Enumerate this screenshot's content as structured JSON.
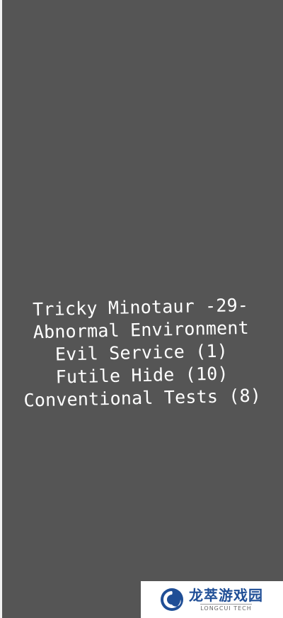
{
  "menu": {
    "items": [
      "Tricky Minotaur -29-",
      "Abnormal Environment",
      "Evil Service (1)",
      "Futile Hide (10)",
      "Conventional Tests (8)"
    ]
  },
  "watermark": {
    "name_cn": "龙萃游戏园",
    "name_en": "LONGCUI TECH",
    "brand_color": "#1f4e96"
  },
  "colors": {
    "background": "#555555",
    "text": "#ffffff"
  }
}
